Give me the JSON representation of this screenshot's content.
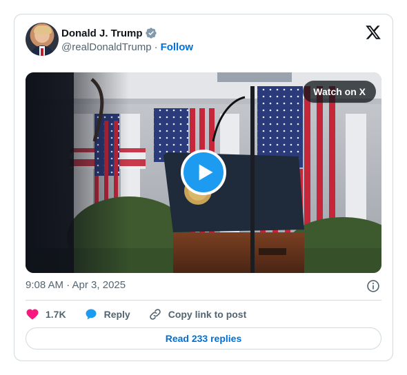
{
  "author": {
    "display_name": "Donald J. Trump",
    "handle": "@realDonaldTrump",
    "separator": "·",
    "follow_label": "Follow",
    "verified_color": "#829aab"
  },
  "brand": {
    "logo_icon": "x-logo-icon"
  },
  "media": {
    "watch_label": "Watch on X",
    "play_icon": "play-icon"
  },
  "timestamp": "9:08 AM · Apr 3, 2025",
  "actions": {
    "likes_count": "1.7K",
    "reply_label": "Reply",
    "copy_label": "Copy link to post"
  },
  "replies_button": "Read 233 replies",
  "colors": {
    "accent": "#1d9bf0",
    "link": "#006fd6",
    "like": "#f91880",
    "muted": "#536471",
    "border": "#cfd9de"
  }
}
